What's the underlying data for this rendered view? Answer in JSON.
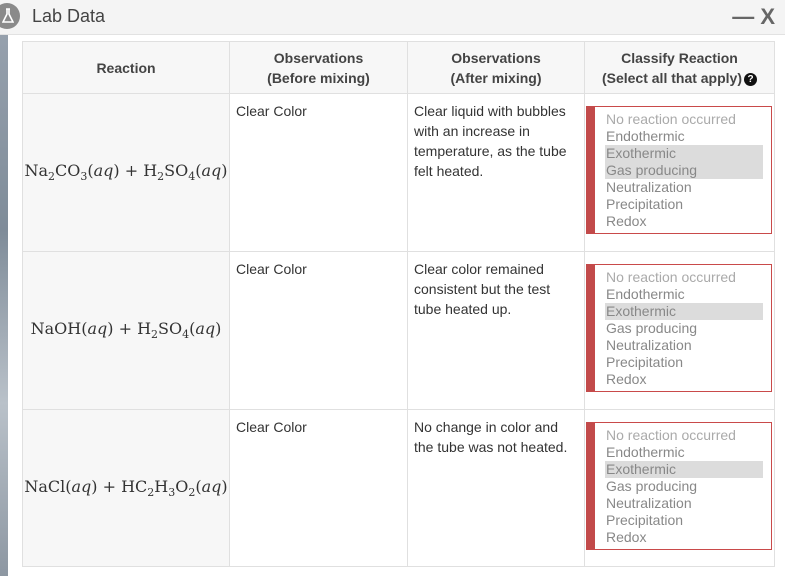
{
  "window": {
    "title": "Lab Data",
    "minimize": "—",
    "close": "X"
  },
  "table": {
    "headers": {
      "reaction": "Reaction",
      "before_line1": "Observations",
      "before_line2": "(Before mixing)",
      "after_line1": "Observations",
      "after_line2": "(After mixing)",
      "classify_line1": "Classify Reaction",
      "classify_line2": "(Select all that apply)",
      "help": "?"
    },
    "options": [
      "No reaction occurred",
      "Endothermic",
      "Exothermic",
      "Gas producing",
      "Neutralization",
      "Precipitation",
      "Redox"
    ],
    "rows": [
      {
        "reaction": "Na2CO3(aq) + H2SO4(aq)",
        "before": "Clear Color",
        "after": "Clear liquid with bubbles with an increase in temperature, as the tube felt heated.",
        "selected": [
          "Exothermic",
          "Gas producing"
        ]
      },
      {
        "reaction": "NaOH(aq) + H2SO4(aq)",
        "before": "Clear Color",
        "after": "Clear color remained consistent but the test tube heated up.",
        "selected": [
          "Exothermic"
        ]
      },
      {
        "reaction": "NaCl(aq) + HC2H3O2(aq)",
        "before": "Clear Color",
        "after": "No change in color and the tube was not heated.",
        "selected": [
          "Exothermic"
        ]
      }
    ]
  },
  "colors": {
    "select_accent": "#c24a4a",
    "selected_bg": "#dcdcdc"
  }
}
